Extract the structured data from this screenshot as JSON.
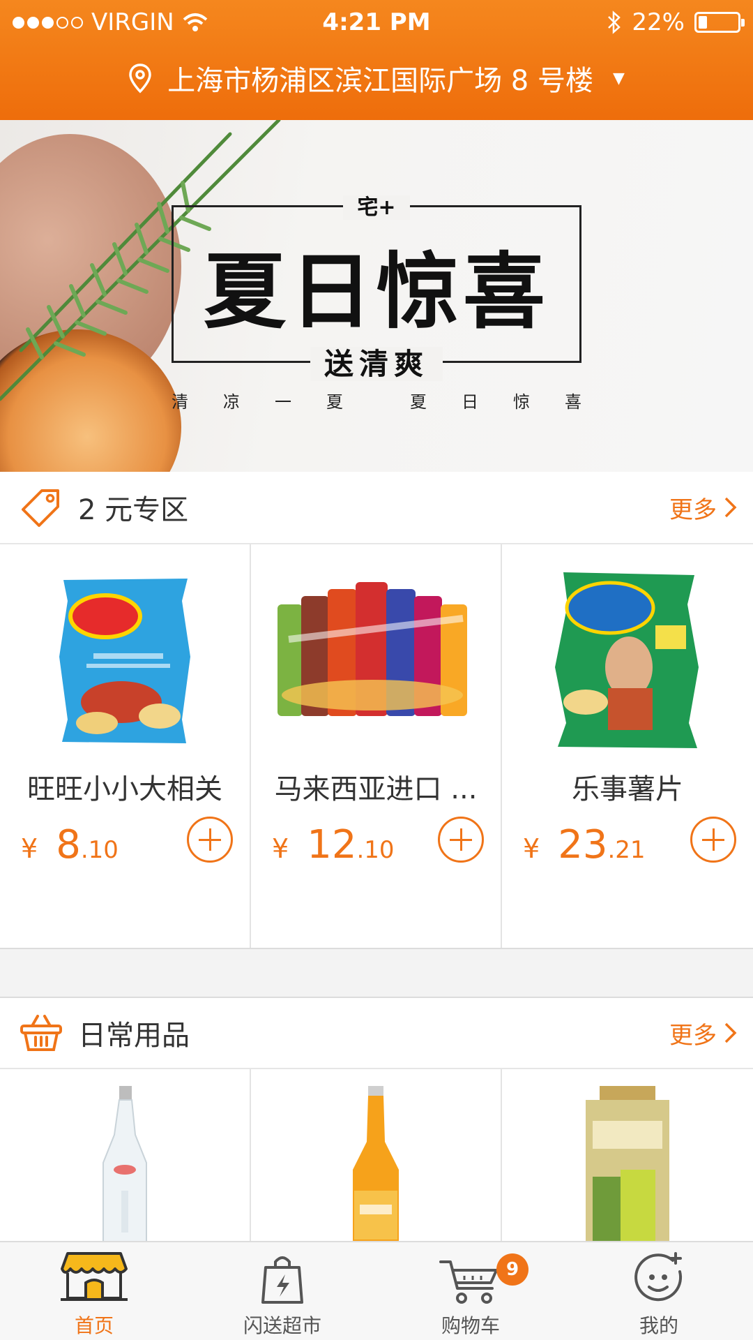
{
  "status_bar": {
    "carrier": "VIRGIN",
    "time": "4:21 PM",
    "battery_text": "22%",
    "battery_level": 0.22,
    "signal_bars_filled": 3,
    "signal_bars_total": 5
  },
  "header": {
    "address": "上海市杨浦区滨江国际广场 8 号楼",
    "accent_color": "#f07418"
  },
  "banner": {
    "top_text": "宅+",
    "title": "夏日惊喜",
    "subtitle": "送清爽",
    "tagline_left": [
      "清",
      "凉",
      "一",
      "夏"
    ],
    "tagline_right": [
      "夏",
      "日",
      "惊",
      "喜"
    ]
  },
  "sections": [
    {
      "title": "2 元专区",
      "more": "更多",
      "icon": "tag-icon",
      "products": [
        {
          "name": "旺旺小小大相关",
          "price_currency": "¥",
          "price_int": "8",
          "price_dec": ".10",
          "image": "lays-chips-bag"
        },
        {
          "name": "马来西亚进口 ...",
          "price_currency": "¥",
          "price_int": "12",
          "price_dec": ".10",
          "image": "jacker-chips-cans"
        },
        {
          "name": "乐事薯片",
          "price_currency": "¥",
          "price_int": "23",
          "price_dec": ".21",
          "image": "copico-chips-bag"
        }
      ]
    },
    {
      "title": "日常用品",
      "more": "更多",
      "icon": "basket-icon",
      "products": [
        {
          "image": "evian-bottle"
        },
        {
          "image": "orange-soda-bottle"
        },
        {
          "image": "limon-powder-pack"
        }
      ]
    }
  ],
  "tabbar": {
    "tabs": [
      {
        "label": "首页",
        "icon": "store-icon",
        "active": true
      },
      {
        "label": "闪送超市",
        "icon": "flash-bag-icon",
        "active": false
      },
      {
        "label": "购物车",
        "icon": "cart-icon",
        "active": false,
        "badge": "9"
      },
      {
        "label": "我的",
        "icon": "profile-smile-icon",
        "active": false
      }
    ]
  }
}
